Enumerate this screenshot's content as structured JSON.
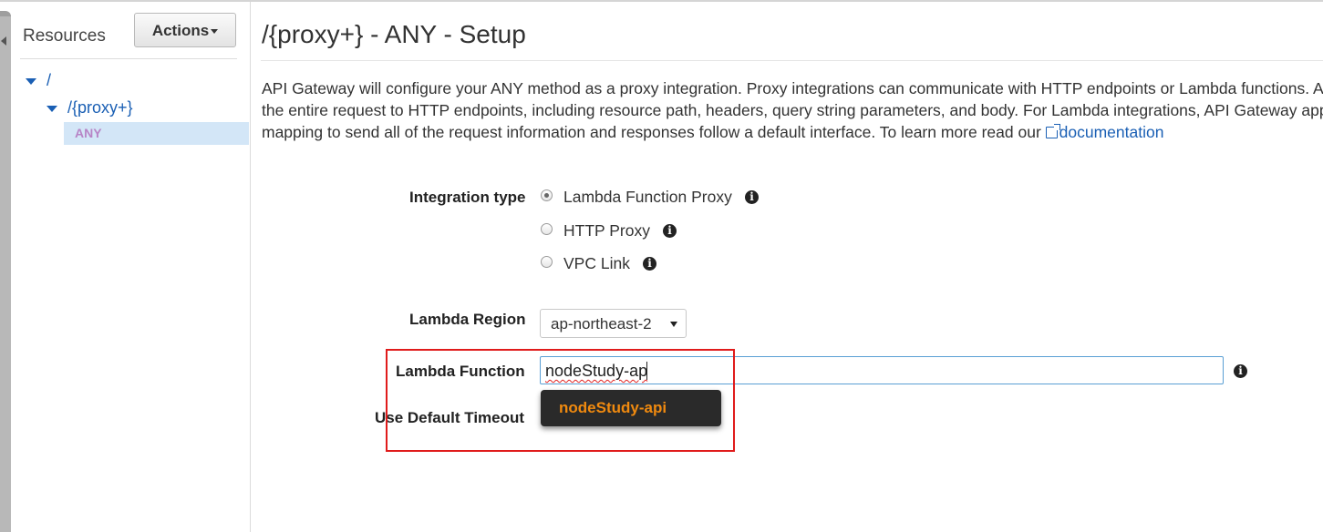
{
  "sidebar": {
    "title": "Resources",
    "actions_label": "Actions",
    "tree": {
      "root": "/",
      "proxy": "/{proxy+}",
      "method": "ANY"
    }
  },
  "main": {
    "title": "/{proxy+} - ANY - Setup",
    "description": [
      "API Gateway will configure your ANY method as a proxy integration. Proxy integrations can communicate with HTTP endpoints or Lambda functions. A",
      "the entire request to HTTP endpoints, including resource path, headers, query string parameters, and body. For Lambda integrations, API Gateway app",
      "mapping to send all of the request information and responses follow a default interface. To learn more read our "
    ],
    "doc_link": "documentation",
    "form": {
      "integration_type_label": "Integration type",
      "options": [
        "Lambda Function Proxy",
        "HTTP Proxy",
        "VPC Link"
      ],
      "selected_option": "Lambda Function Proxy",
      "lambda_region_label": "Lambda Region",
      "lambda_region_value": "ap-northeast-2",
      "lambda_function_label": "Lambda Function",
      "lambda_function_value": "nodeStudy-ap",
      "autocomplete_suggestion": "nodeStudy-api",
      "default_timeout_label": "Use Default Timeout"
    }
  },
  "colors": {
    "link": "#1a5fb4",
    "method_text": "#b784c6",
    "suggestion_text": "#f08a0f",
    "highlight_border": "#e01b1b"
  },
  "icons": [
    "info-icon",
    "external-link-icon",
    "caret-down-icon",
    "expand-triangle-icon"
  ]
}
